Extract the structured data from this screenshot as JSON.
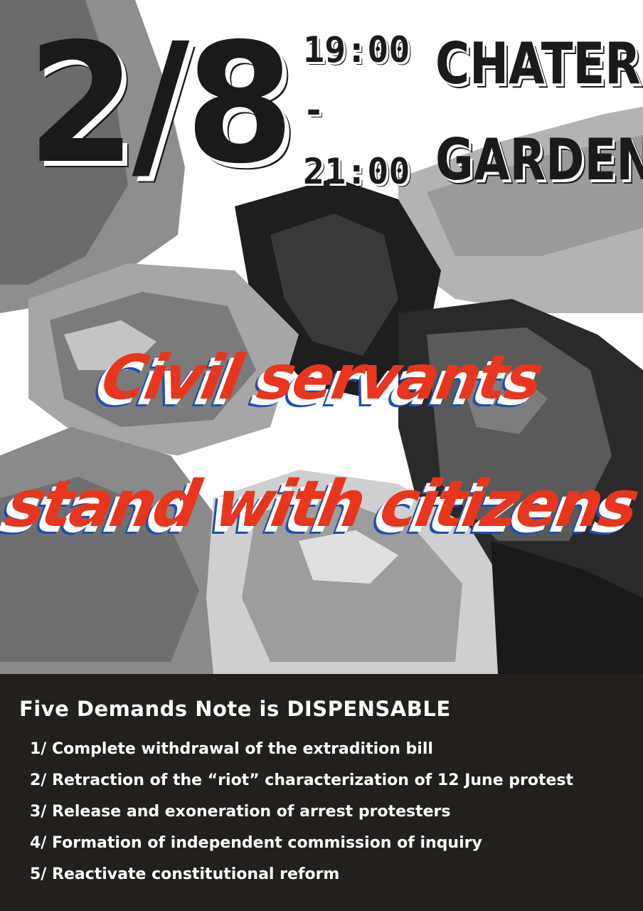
{
  "event": {
    "date": "2/8",
    "time_start": "19:00",
    "time_separator": "-",
    "time_end": "21:00",
    "venue_line1": "CHATER",
    "venue_line2": "GARDEN"
  },
  "headline": {
    "line1": "Civil servants",
    "line2": "stand with citizens"
  },
  "demands": {
    "title": "Five Demands Note is DISPENSABLE",
    "items": [
      "1/ Complete withdrawal of the extradition bill",
      "2/ Retraction of the “riot” characterization of 12 June protest",
      "3/ Release and exoneration of arrest protesters",
      "4/ Formation of independent commission of inquiry",
      "5/ Reactivate constitutional reform"
    ]
  },
  "colors": {
    "background": "#ffffff",
    "ink": "#1a1a1a",
    "headline_red": "#e8361e",
    "headline_blue_shadow": "#1f4fae",
    "panel": "#231f1d"
  },
  "artwork": "interlocked-hands-illustration"
}
